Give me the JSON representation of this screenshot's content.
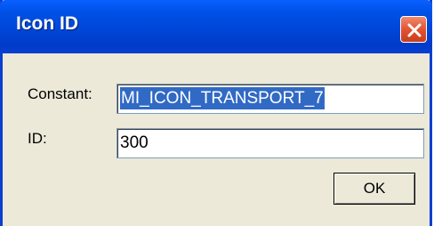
{
  "window": {
    "title": "Icon ID"
  },
  "form": {
    "constant_label": "Constant:",
    "constant_value": "MI_ICON_TRANSPORT_7",
    "id_label": "ID:",
    "id_value": "300"
  },
  "buttons": {
    "ok_label": "OK"
  },
  "icons": {
    "close": "close-icon"
  },
  "colors": {
    "titlebar": "#0046d8",
    "close_button": "#e1502f",
    "selection": "#316ac5",
    "dialog_bg": "#ece9d8"
  }
}
